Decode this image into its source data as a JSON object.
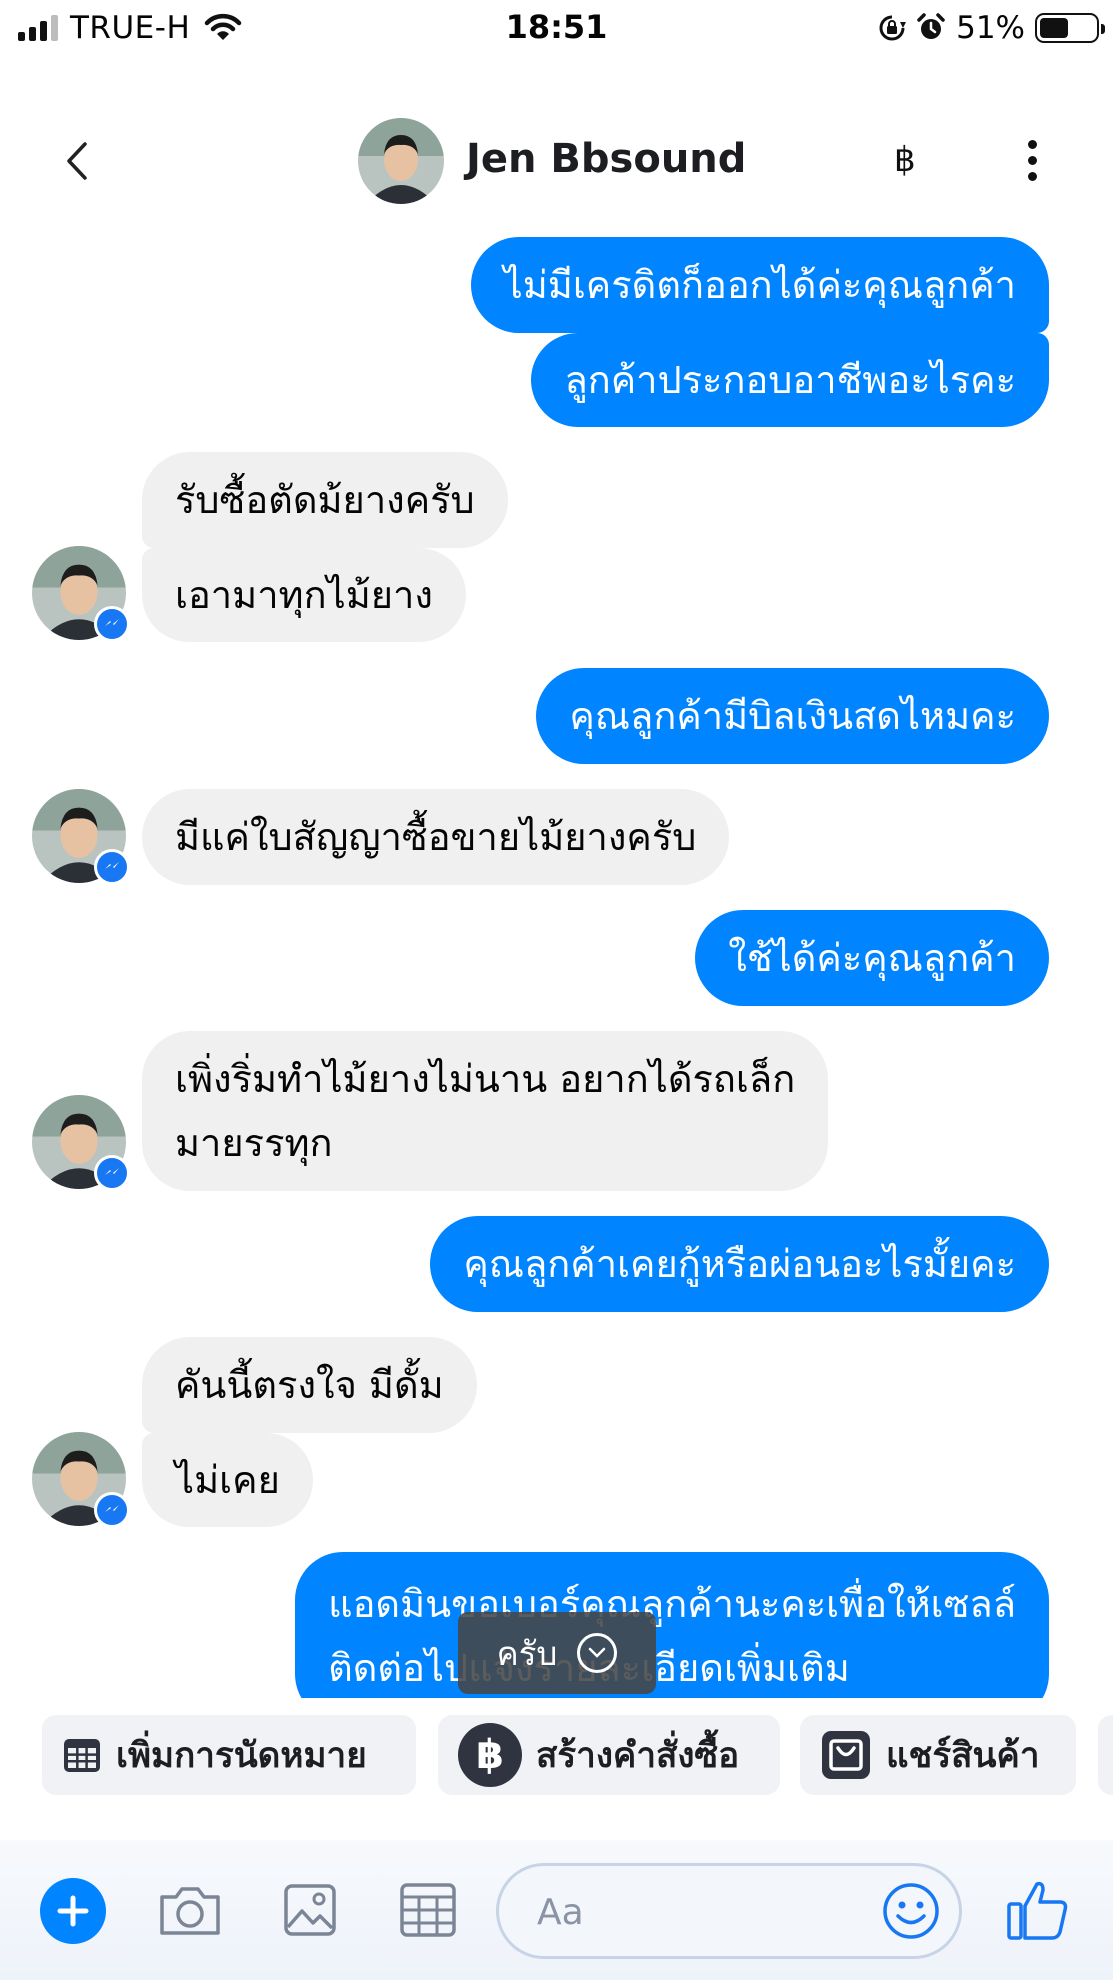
{
  "status_bar": {
    "carrier": "TRUE-H",
    "time": "18:51",
    "battery_percent": "51%",
    "battery_level": 0.51,
    "signal_bars": 3
  },
  "header": {
    "contact_name": "Jen Bbsound",
    "currency_symbol": "฿",
    "icons": [
      "back-icon",
      "baht-icon",
      "more-icon"
    ]
  },
  "messages": [
    {
      "sender": "me",
      "text": "ไม่มีเครดิตก็ออกได้ค่ะคุณลูกค้า"
    },
    {
      "sender": "me",
      "text": "ลูกค้าประกอบอาชีพอะไรคะ"
    },
    {
      "sender": "contact",
      "text": "รับซื้อตัดม้ยางครับ"
    },
    {
      "sender": "contact",
      "text": "เอามาทุกไม้ยาง"
    },
    {
      "sender": "me",
      "text": "คุณลูกค้ามีบิลเงินสดไหมคะ"
    },
    {
      "sender": "contact",
      "text": "มีแค่ใบสัญญาซื้อขายไม้ยางครับ"
    },
    {
      "sender": "me",
      "text": "ใช้ได้ค่ะคุณลูกค้า"
    },
    {
      "sender": "contact",
      "text_lines": [
        "เพิ่งริ่มทำไม้ยางไม่นาน อยากได้รถเล็ก",
        "มายรรทุก"
      ]
    },
    {
      "sender": "me",
      "text": "คุณลูกค้าเคยกู้หรือผ่อนอะไรมั้ยคะ"
    },
    {
      "sender": "contact",
      "text": "คันนี้ตรงใจ มีดั้ม"
    },
    {
      "sender": "contact",
      "text": "ไม่เคย"
    },
    {
      "sender": "me",
      "text_lines": [
        "แอดมินขอเบอร์คุณลูกค้านะคะเพื่อให้เซลล์",
        "ติดต่อไปแจ้งรายละเอียดเพิ่มเติม"
      ]
    }
  ],
  "jump_pill": {
    "label": "ครับ"
  },
  "quick_actions": [
    {
      "label": "เพิ่มการนัดหมาย",
      "icon": "calendar-icon"
    },
    {
      "label": "สร้างคำสั่งซื้อ",
      "icon": "baht-icon",
      "glyph": "฿"
    },
    {
      "label": "แชร์สินค้า",
      "icon": "shopping-bag-icon"
    }
  ],
  "composer": {
    "placeholder": "Aa",
    "icons": [
      "plus-icon",
      "camera-icon",
      "image-icon",
      "calendar-icon",
      "emoji-icon",
      "thumbs-up-icon"
    ]
  },
  "colors": {
    "outgoing_bubble": "#0084ff",
    "incoming_bubble": "#f0f0f0",
    "messenger_badge": "#1877f2"
  }
}
